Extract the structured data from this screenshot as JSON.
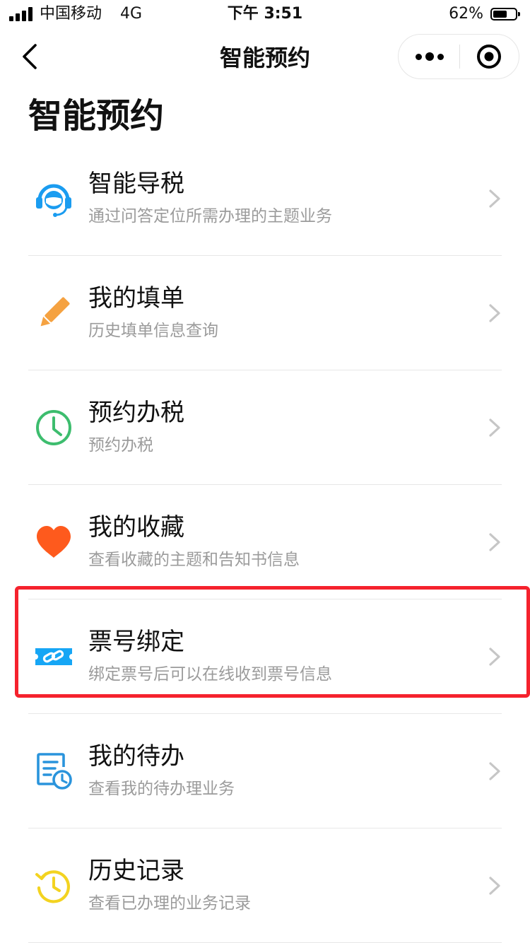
{
  "status_bar": {
    "carrier": "中国移动",
    "network": "4G",
    "time": "下午 3:51",
    "battery_pct": "62%",
    "battery_level": 0.62
  },
  "nav": {
    "title": "智能预约",
    "back_icon": "chevron-left-icon",
    "more_icon": "more-dots-icon",
    "close_icon": "target-circle-icon"
  },
  "page_heading": "智能预约",
  "items": [
    {
      "title": "智能导税",
      "desc": "通过问答定位所需办理的主题业务",
      "icon": "customer-service-icon",
      "color": "#1a9cf0"
    },
    {
      "title": "我的填单",
      "desc": "历史填单信息查询",
      "icon": "pencil-icon",
      "color": "#f5a241"
    },
    {
      "title": "预约办税",
      "desc": "预约办税",
      "icon": "clock-icon",
      "color": "#3dbd6e"
    },
    {
      "title": "我的收藏",
      "desc": "查看收藏的主题和告知书信息",
      "icon": "heart-icon",
      "color": "#fe5a1d"
    },
    {
      "title": "票号绑定",
      "desc": "绑定票号后可以在线收到票号信息",
      "icon": "ticket-link-icon",
      "color": "#16a6f5",
      "highlighted": true,
      "highlight_color": "#f5222d"
    },
    {
      "title": "我的待办",
      "desc": "查看我的待办理业务",
      "icon": "todo-document-icon",
      "color": "#2a94dc"
    },
    {
      "title": "历史记录",
      "desc": "查看已办理的业务记录",
      "icon": "history-clock-icon",
      "color": "#f3d320"
    }
  ]
}
